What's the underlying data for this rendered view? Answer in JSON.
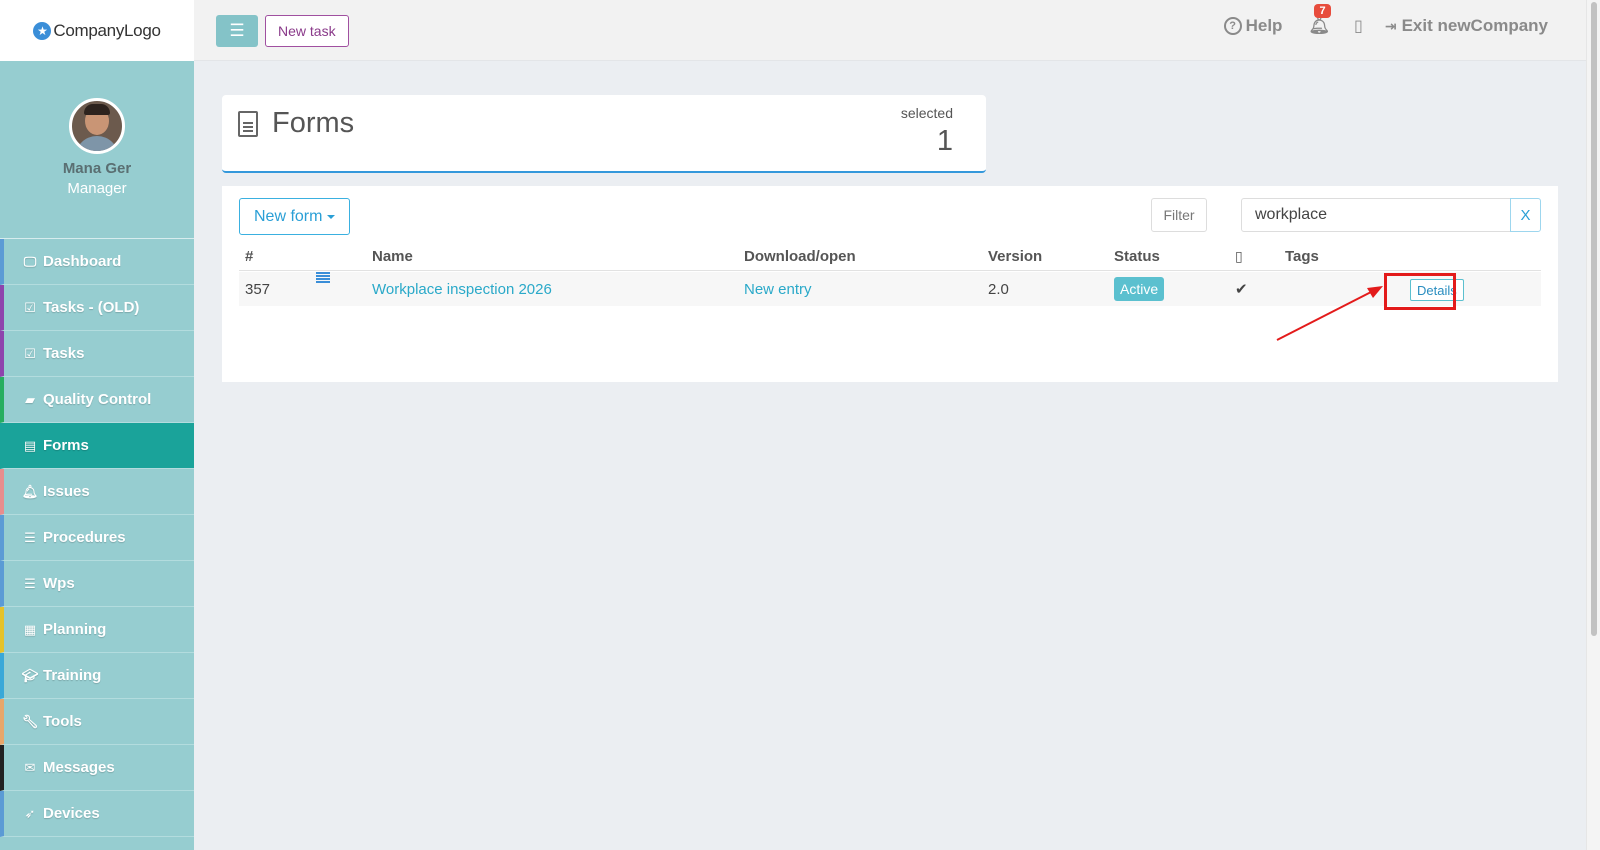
{
  "brand": {
    "logo_text": "CompanyLogo"
  },
  "user": {
    "name": "Mana Ger",
    "role": "Manager"
  },
  "sidebar": {
    "items": [
      {
        "label": "Dashboard",
        "icon": "monitor-icon",
        "accent": "#5b9bd5",
        "active": false
      },
      {
        "label": "Tasks - (OLD)",
        "icon": "checkbox-icon",
        "accent": "#8e44ad",
        "active": false
      },
      {
        "label": "Tasks",
        "icon": "checkbox-icon",
        "accent": "#8e44ad",
        "active": false
      },
      {
        "label": "Quality Control",
        "icon": "book-icon",
        "accent": "#27ae60",
        "active": false
      },
      {
        "label": "Forms",
        "icon": "document-icon",
        "accent": "#1aa39a",
        "active": true
      },
      {
        "label": "Issues",
        "icon": "bell-icon",
        "accent": "#e88d8d",
        "active": false
      },
      {
        "label": "Procedures",
        "icon": "list-icon",
        "accent": "#5b9bd5",
        "active": false
      },
      {
        "label": "Wps",
        "icon": "list-icon",
        "accent": "#5b9bd5",
        "active": false
      },
      {
        "label": "Planning",
        "icon": "calendar-icon",
        "accent": "#e6c229",
        "active": false
      },
      {
        "label": "Training",
        "icon": "graduation-cap-icon",
        "accent": "#3aa8d8",
        "active": false
      },
      {
        "label": "Tools",
        "icon": "wrench-icon",
        "accent": "#e8a66a",
        "active": false
      },
      {
        "label": "Messages",
        "icon": "envelope-icon",
        "accent": "#222222",
        "active": false
      },
      {
        "label": "Devices",
        "icon": "rocket-icon",
        "accent": "#5b9bd5",
        "active": false
      }
    ]
  },
  "topbar": {
    "new_task_label": "New task",
    "help_label": "Help",
    "notification_count": "7",
    "exit_label": "Exit newCompany"
  },
  "forms_panel": {
    "title": "Forms",
    "selected_label": "selected",
    "selected_count": "1"
  },
  "toolbar": {
    "new_form_label": "New form",
    "filter_label": "Filter",
    "search_value": "workplace",
    "clear_label": "X"
  },
  "table": {
    "columns": [
      "#",
      "Name",
      "Download/open",
      "Version",
      "Status",
      "Tags"
    ],
    "rows": [
      {
        "id": "357",
        "name": "Workplace inspection 2026",
        "download": "New entry",
        "version": "2.0",
        "status": "Active",
        "mobile": true,
        "details_label": "Details"
      }
    ]
  },
  "colors": {
    "sidebar_bg": "#96cdd0",
    "active_nav": "#1aa39a",
    "link": "#2aa9c9",
    "annotation": "#e31b1b"
  }
}
